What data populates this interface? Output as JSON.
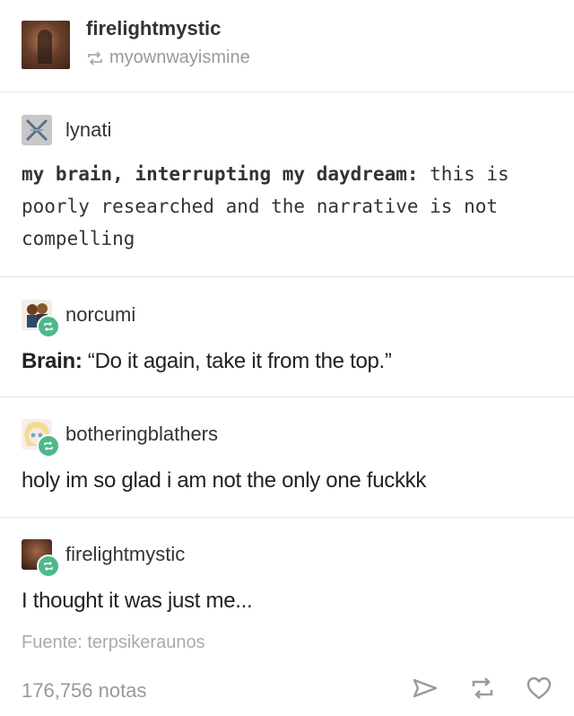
{
  "header": {
    "username": "firelightmystic",
    "reblogged_from": "myownwayismine"
  },
  "posts": [
    {
      "username": "lynati",
      "lines": [
        {
          "bold": "my brain, interrupting my daydream:",
          "rest": " this is"
        },
        {
          "bold": "",
          "rest": "poorly researched and the narrative is not"
        },
        {
          "bold": "",
          "rest": "compelling"
        }
      ]
    },
    {
      "username": "norcumi",
      "bold": "Brain:",
      "text": " “Do it again, take it from the top.”"
    },
    {
      "username": "botheringblathers",
      "text": "holy im so glad i am not the only one fuckkk"
    },
    {
      "username": "firelightmystic",
      "text": "I thought it was just me..."
    }
  ],
  "footer": {
    "source": "Fuente: terpsikeraunos",
    "notes": "176,756 notas"
  },
  "icons": {
    "reblog_badge_color": "#4fb88a",
    "action_color": "#9a9a9a"
  }
}
